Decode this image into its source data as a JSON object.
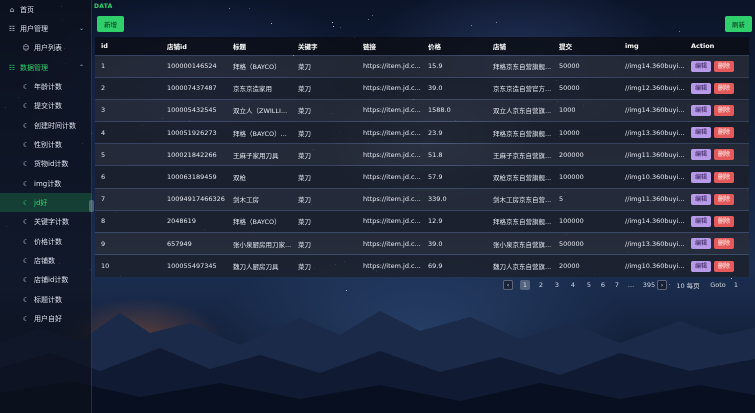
{
  "sidebar": {
    "items": [
      {
        "label": "首页",
        "icon": "home-icon",
        "glyph": "⌂",
        "level": 0,
        "state": ""
      },
      {
        "label": "用户管理",
        "icon": "users-icon",
        "glyph": "☷",
        "level": 0,
        "state": "",
        "arrow": "⌄"
      },
      {
        "label": "用户列表",
        "icon": "user-list-icon",
        "glyph": "☺",
        "level": 1,
        "state": ""
      },
      {
        "label": "数据管理",
        "icon": "data-icon",
        "glyph": "☷",
        "level": 0,
        "state": "active-group",
        "arrow": "⌃"
      },
      {
        "label": "年龄计数",
        "icon": "moon-icon",
        "glyph": "☾",
        "level": 1,
        "state": ""
      },
      {
        "label": "提交计数",
        "icon": "moon-icon",
        "glyph": "☾",
        "level": 1,
        "state": ""
      },
      {
        "label": "创建时间计数",
        "icon": "moon-icon",
        "glyph": "☾",
        "level": 1,
        "state": ""
      },
      {
        "label": "性别计数",
        "icon": "moon-icon",
        "glyph": "☾",
        "level": 1,
        "state": ""
      },
      {
        "label": "货物id计数",
        "icon": "moon-icon",
        "glyph": "☾",
        "level": 1,
        "state": ""
      },
      {
        "label": "img计数",
        "icon": "moon-icon",
        "glyph": "☾",
        "level": 1,
        "state": ""
      },
      {
        "label": "jd好",
        "icon": "moon-icon",
        "glyph": "☾",
        "level": 1,
        "state": "active"
      },
      {
        "label": "关键字计数",
        "icon": "moon-icon",
        "glyph": "☾",
        "level": 1,
        "state": ""
      },
      {
        "label": "价格计数",
        "icon": "moon-icon",
        "glyph": "☾",
        "level": 1,
        "state": ""
      },
      {
        "label": "店铺数",
        "icon": "moon-icon",
        "glyph": "☾",
        "level": 1,
        "state": ""
      },
      {
        "label": "店铺id计数",
        "icon": "moon-icon",
        "glyph": "☾",
        "level": 1,
        "state": ""
      },
      {
        "label": "标题计数",
        "icon": "moon-icon",
        "glyph": "☾",
        "level": 1,
        "state": ""
      },
      {
        "label": "用户自好",
        "icon": "moon-icon",
        "glyph": "☾",
        "level": 1,
        "state": ""
      }
    ]
  },
  "header": {
    "breadcrumb": "DATA",
    "add_label": "新增",
    "refresh_label": "刷新"
  },
  "table": {
    "columns": [
      "id",
      "店铺id",
      "标题",
      "关键字",
      "链接",
      "价格",
      "店铺",
      "提交",
      "img",
      "Action"
    ],
    "edit_label": "编辑",
    "delete_label": "删除",
    "rows": [
      [
        "1",
        "100000146524",
        "拜格（BAYCO）",
        "菜刀",
        "https://item.jd.c...",
        "15.9",
        "拜格京东自营旗舰...",
        "50000",
        "//img14.360buyi..."
      ],
      [
        "2",
        "100007437487",
        "京东京造家用",
        "菜刀",
        "https://item.jd.c...",
        "39.0",
        "京东京造自营官方...",
        "50000",
        "//img12.360buyi..."
      ],
      [
        "3",
        "100005432545",
        "双立人（ZWILLI...",
        "菜刀",
        "https://item.jd.c...",
        "1588.0",
        "双立人京东自营旗...",
        "1000",
        "//img14.360buyi..."
      ],
      [
        "4",
        "100051926273",
        "拜格（BAYCO）...",
        "菜刀",
        "https://item.jd.c...",
        "23.9",
        "拜格京东自营旗舰...",
        "10000",
        "//img13.360buyi..."
      ],
      [
        "5",
        "100021842266",
        "王麻子家用刀具",
        "菜刀",
        "https://item.jd.c...",
        "51.8",
        "王麻子京东自营旗...",
        "200000",
        "//img11.360buyi..."
      ],
      [
        "6",
        "100063189459",
        "双枪",
        "菜刀",
        "https://item.jd.c...",
        "57.9",
        "双枪京东自营旗舰...",
        "100000",
        "//img10.360buyi..."
      ],
      [
        "7",
        "10094917466326",
        "剑木工房",
        "菜刀",
        "https://item.jd.c...",
        "339.0",
        "剑木工房京东自营...",
        "5",
        "//img11.360buyi..."
      ],
      [
        "8",
        "2048619",
        "拜格（BAYCO）",
        "菜刀",
        "https://item.jd.c...",
        "12.9",
        "拜格京东自营旗舰...",
        "100000",
        "//img14.360buyi..."
      ],
      [
        "9",
        "657949",
        "张小泉厨房用刀家...",
        "菜刀",
        "https://item.jd.c...",
        "39.0",
        "张小泉京东自营旗...",
        "500000",
        "//img13.360buyi..."
      ],
      [
        "10",
        "100055497345",
        "魏刀人厨房刀具",
        "菜刀",
        "https://item.jd.c...",
        "69.9",
        "魏刀人京东自营旗...",
        "20000",
        "//img10.360buyi..."
      ]
    ]
  },
  "pagination": {
    "prev": "‹",
    "pages": [
      "1",
      "2",
      "3",
      "4",
      "5",
      "6",
      "7",
      "…",
      "395"
    ],
    "active_page": "1",
    "next": "›",
    "page_size": "10 每页",
    "goto_label": "Goto",
    "goto_value": "1"
  }
}
